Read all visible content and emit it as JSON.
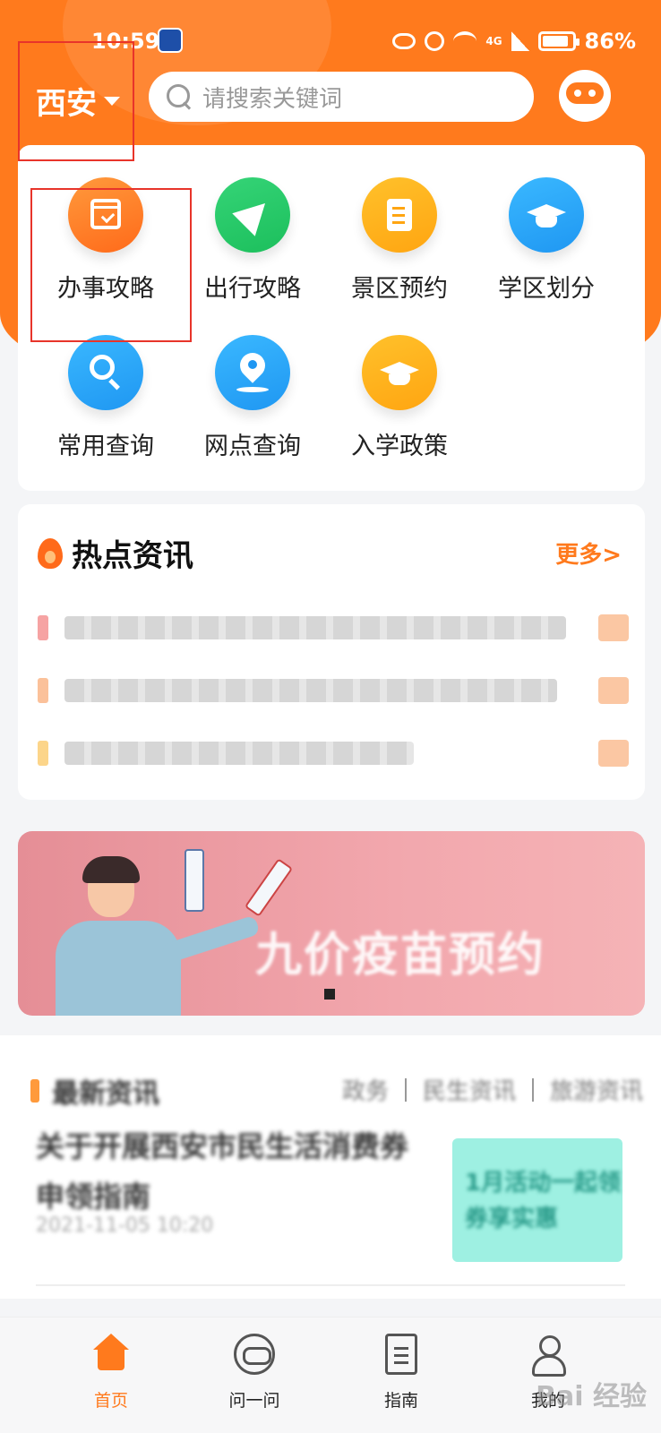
{
  "status_bar": {
    "time": "10:59",
    "network": "4G",
    "battery": "86%"
  },
  "header": {
    "city": "西安",
    "search_placeholder": "请搜索关键词"
  },
  "services": [
    {
      "label": "办事攻略",
      "icon": "calendar-check-icon",
      "color": "#ff7a1d"
    },
    {
      "label": "出行攻略",
      "icon": "send-arrow-icon",
      "color": "#1cbf5c"
    },
    {
      "label": "景区预约",
      "icon": "document-icon",
      "color": "#ffa511"
    },
    {
      "label": "学区划分",
      "icon": "graduation-cap-icon",
      "color": "#1f97f2"
    },
    {
      "label": "常用查询",
      "icon": "search-icon",
      "color": "#1f97f2"
    },
    {
      "label": "网点查询",
      "icon": "location-pin-icon",
      "color": "#1f97f2"
    },
    {
      "label": "入学政策",
      "icon": "graduation-cap-icon",
      "color": "#ffa511"
    }
  ],
  "hot_news": {
    "title": "热点资讯",
    "more": "更多>",
    "item_count_visible": 3
  },
  "banner": {
    "title": "九价疫苗预约"
  },
  "local_info": {
    "title": "最新资讯",
    "tabs": [
      "政务",
      "民生资讯",
      "旅游资讯"
    ],
    "article": {
      "title": "关于开展西安市民生活消费券申领指南",
      "date": "2021-11-05 10:20",
      "thumb_text": "1月活动一起领券享实惠"
    }
  },
  "bottom_nav": [
    {
      "label": "首页",
      "icon": "home-icon",
      "active": true
    },
    {
      "label": "问一问",
      "icon": "robot-chat-icon",
      "active": false
    },
    {
      "label": "指南",
      "icon": "guide-document-icon",
      "active": false
    },
    {
      "label": "我的",
      "icon": "user-icon",
      "active": false
    }
  ],
  "watermark": "Bai 经验",
  "colors": {
    "brand": "#ff7a1d",
    "background": "#f4f5f7",
    "annotation": "#e8342a"
  }
}
